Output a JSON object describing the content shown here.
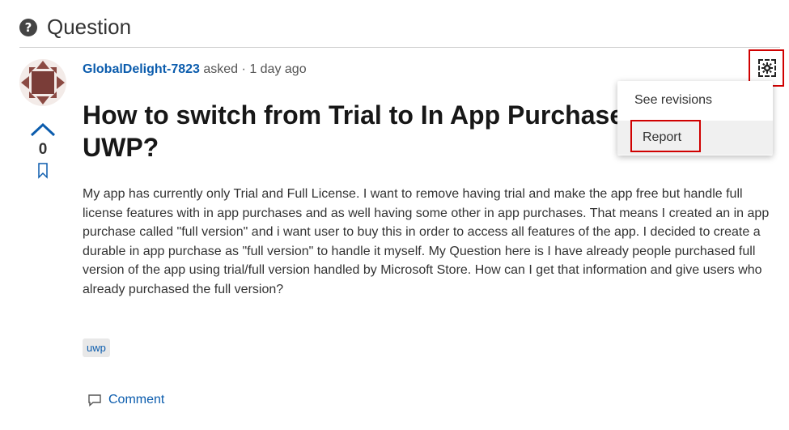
{
  "header": {
    "title": "Question",
    "icon": "question-circle-icon"
  },
  "question": {
    "author": "GlobalDelight-7823",
    "asked_label": "asked",
    "separator": "·",
    "time": "1 day ago",
    "title": "How to switch from Trial to In App Purchase UWP?",
    "body": "My app has currently only Trial and Full License. I want to remove having trial and make the app free but handle full license features with in app purchases and as well having some other in app purchases. That means I created an in app purchase called \"full version\" and i want user to buy this in order to access all features of the app. I decided to create a durable in app purchase as \"full version\" to handle it myself. My Question here is I have already people purchased full version of the app using trial/full version handled by Microsoft Store. How can I get that information and give users who already purchased the full version?",
    "vote_count": "0",
    "tags": [
      "uwp"
    ]
  },
  "actions": {
    "comment_label": "Comment"
  },
  "menu": {
    "items": [
      {
        "label": "See revisions"
      },
      {
        "label": "Report"
      }
    ]
  },
  "colors": {
    "link": "#0b5cad",
    "highlight": "#d00000",
    "avatar_bg": "#8b4a43",
    "avatar_dark": "#6e2f2a"
  }
}
